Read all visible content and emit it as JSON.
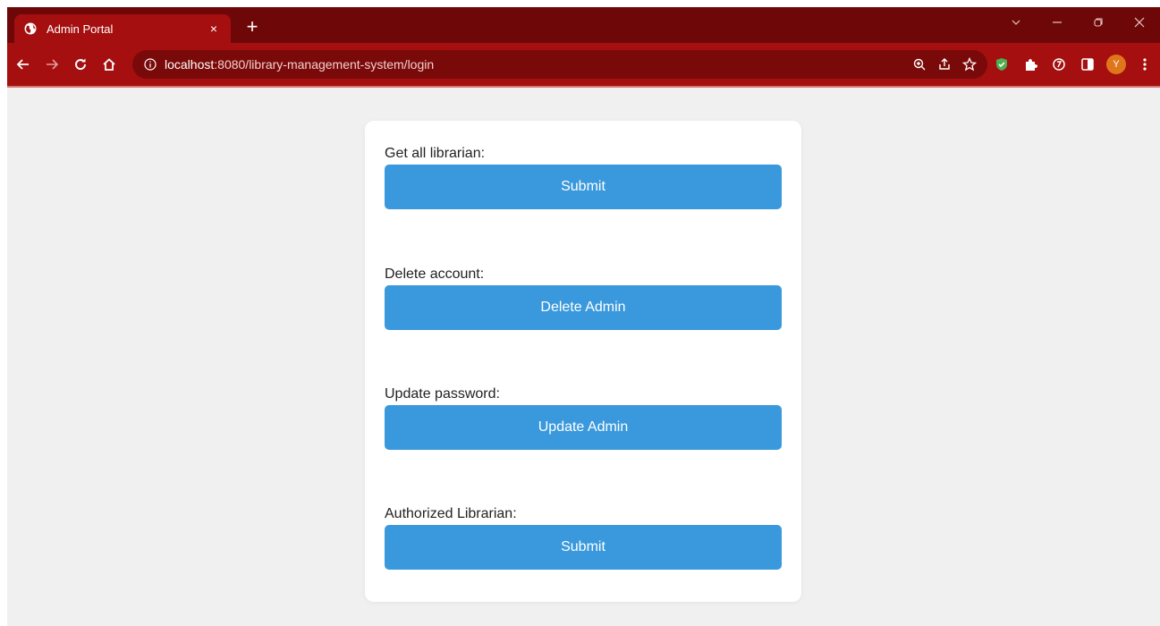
{
  "browser": {
    "tab": {
      "title": "Admin Portal",
      "close_glyph": "×",
      "favicon": "globe-icon"
    },
    "new_tab_glyph": "+",
    "window_controls": {
      "dropdown": "⌄",
      "minimize": "–",
      "restore": "❐",
      "close": "✕"
    },
    "nav": {
      "back": "←",
      "forward": "→",
      "reload": "C",
      "home": "⌂"
    },
    "url": {
      "host": "localhost",
      "rest": ":8080/library-management-system/login"
    },
    "omnibox_icons": [
      "zoom-icon",
      "share-icon",
      "bookmark-star-icon"
    ],
    "extension_icons": [
      "shield-extension-icon",
      "puzzle-extension-icon",
      "refresh-extension-icon",
      "side-panel-icon"
    ],
    "avatar_letter": "Y",
    "menu_glyph": "⋮",
    "colors": {
      "tabstrip": "#6e0808",
      "toolbar": "#a50f0f",
      "omnibox": "#7a0a0a",
      "avatar": "#e0761c"
    }
  },
  "admin": {
    "sections": [
      {
        "label": "Get all librarian:",
        "button": "Submit"
      },
      {
        "label": "Delete account:",
        "button": "Delete Admin"
      },
      {
        "label": "Update password:",
        "button": "Update Admin"
      },
      {
        "label": "Authorized Librarian:",
        "button": "Submit"
      }
    ],
    "colors": {
      "button": "#3a99dc",
      "page_bg": "#f0f0f0",
      "card_bg": "#ffffff"
    }
  }
}
